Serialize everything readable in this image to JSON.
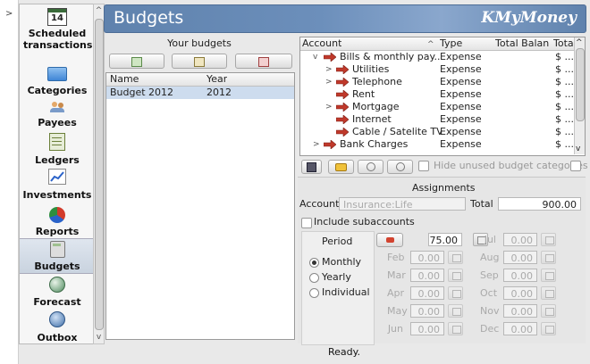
{
  "nav": {
    "items": [
      {
        "label": "Scheduled transactions",
        "icon": "calendar-icon",
        "day": "14"
      },
      {
        "label": "Categories",
        "icon": "folder-icon"
      },
      {
        "label": "Payees",
        "icon": "people-icon"
      },
      {
        "label": "Ledgers",
        "icon": "ledger-icon"
      },
      {
        "label": "Investments",
        "icon": "chart-icon"
      },
      {
        "label": "Reports",
        "icon": "pie-icon"
      },
      {
        "label": "Budgets",
        "icon": "calculator-icon"
      },
      {
        "label": "Forecast",
        "icon": "crystal-ball-icon"
      },
      {
        "label": "Outbox",
        "icon": "globe-icon"
      }
    ],
    "selected": "Budgets"
  },
  "header": {
    "title": "Budgets",
    "logo": "KMyMoney"
  },
  "budgets": {
    "title": "Your budgets",
    "columns": [
      "Name",
      "Year"
    ],
    "rows": [
      {
        "name": "Budget 2012",
        "year": "2012"
      }
    ]
  },
  "accounts": {
    "columns": [
      "Account",
      "Type",
      "Total Balance",
      "Tota"
    ],
    "rows": [
      {
        "name": "Bills & monthly pay...",
        "type": "Expense",
        "total": "$ ...",
        "level": 1,
        "expanded": true
      },
      {
        "name": "Utilities",
        "type": "Expense",
        "total": "$ ...",
        "level": 2,
        "expander": true
      },
      {
        "name": "Telephone",
        "type": "Expense",
        "total": "$ ...",
        "level": 2,
        "expander": true
      },
      {
        "name": "Rent",
        "type": "Expense",
        "total": "$ ...",
        "level": 2,
        "expander": false
      },
      {
        "name": "Mortgage",
        "type": "Expense",
        "total": "$ ...",
        "level": 2,
        "expander": true
      },
      {
        "name": "Internet",
        "type": "Expense",
        "total": "$ ...",
        "level": 2,
        "expander": false
      },
      {
        "name": "Cable / Satelite TV",
        "type": "Expense",
        "total": "$ ...",
        "level": 2,
        "expander": false
      },
      {
        "name": "Bank Charges",
        "type": "Expense",
        "total": "$ ...",
        "level": 1,
        "expander": true
      }
    ]
  },
  "toolbar": {
    "hide_unused_label": "Hide unused budget categories"
  },
  "assignments": {
    "title": "Assignments",
    "account_label": "Account",
    "account_value": "Insurance:Life",
    "total_label": "Total",
    "total_value": "900.00",
    "include_sub_label": "Include subaccounts",
    "period_label": "Period",
    "period_value": "75.00",
    "options": [
      "Monthly",
      "Yearly",
      "Individual"
    ],
    "selected_option": "Monthly",
    "months": [
      {
        "name": "Jul",
        "value": "0.00"
      },
      {
        "name": "Feb",
        "value": "0.00"
      },
      {
        "name": "Aug",
        "value": "0.00"
      },
      {
        "name": "Mar",
        "value": "0.00"
      },
      {
        "name": "Sep",
        "value": "0.00"
      },
      {
        "name": "Apr",
        "value": "0.00"
      },
      {
        "name": "Oct",
        "value": "0.00"
      },
      {
        "name": "May",
        "value": "0.00"
      },
      {
        "name": "Nov",
        "value": "0.00"
      },
      {
        "name": "Jun",
        "value": "0.00"
      },
      {
        "name": "Dec",
        "value": "0.00"
      }
    ]
  },
  "status": "Ready."
}
